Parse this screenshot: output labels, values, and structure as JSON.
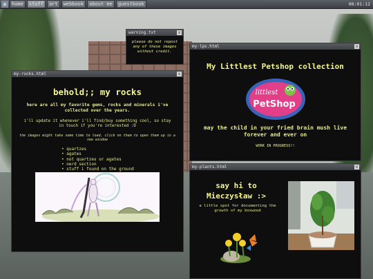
{
  "taskbar": {
    "logo": "✿",
    "items": [
      "home",
      "stuff",
      "art",
      "webbook",
      "about me",
      "guestbook"
    ],
    "clock": "08:01:12"
  },
  "warning_window": {
    "title": "warning.txt",
    "text": "please do not repost any of these images without credit."
  },
  "rocks_window": {
    "title": "my-rocks.html",
    "heading": "behold;; my rocks",
    "intro": "here are all my favorite gems, rocks and minerals i've collected over the years.",
    "update_note": "i'll update it whenever i'll find/buy something cool, so stay in touch if you're interested :D",
    "load_note": "the images might take some time to load, click on them to open them up in a new window",
    "list": [
      "quartzes",
      "agates",
      "not quartzes or agates",
      "nerd section",
      "stuff i found on the ground"
    ]
  },
  "lps_window": {
    "title": "my-lps.html",
    "heading": "My Littlest Petshop collection",
    "logo_text_top": "littlest",
    "logo_text_bottom": "PetShop",
    "tagline": "may the child in your fried brain mush live forever and ever on",
    "status": "WORK IN PROGRESS!!"
  },
  "plants_window": {
    "title": "my-plants.html",
    "heading": "say hi to Mieczysław :>",
    "text": "a little spot for documenting the growth of my boxwood"
  },
  "close_glyph": "x",
  "colors": {
    "text": "#e6e98a",
    "window_bg": "#0e0e0e",
    "titlebar": "#4a4e53"
  }
}
